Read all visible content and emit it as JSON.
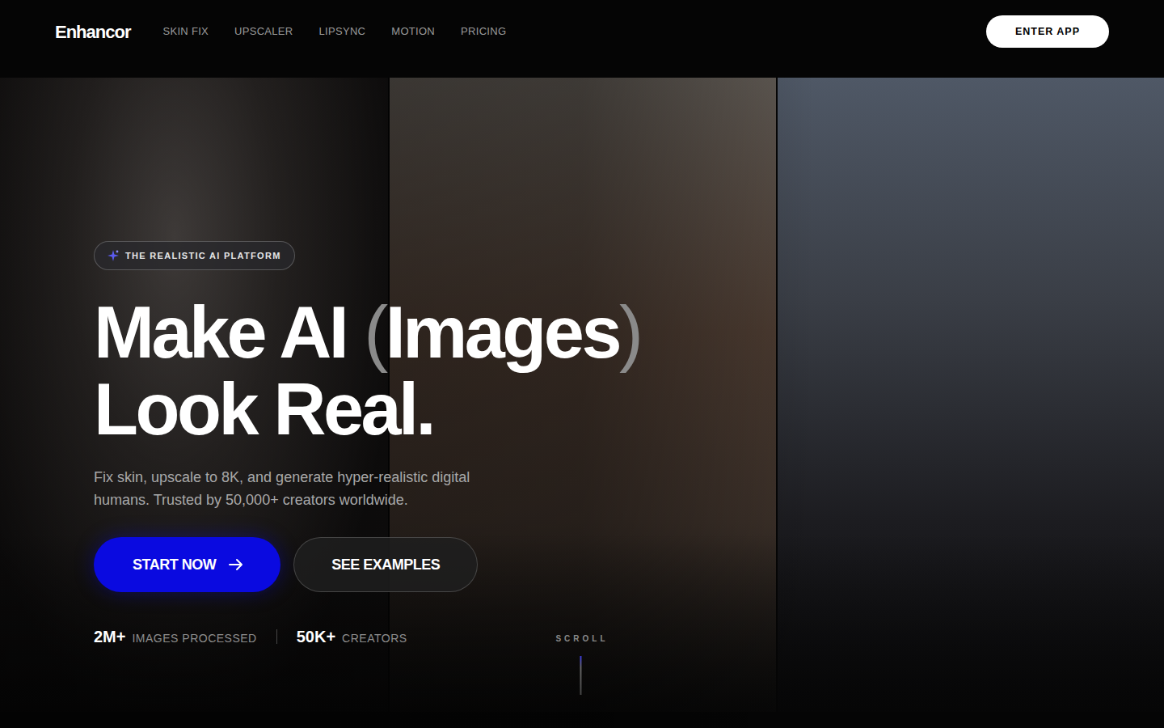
{
  "brand": "Enhancor",
  "nav": [
    {
      "label": "SKIN FIX"
    },
    {
      "label": "UPSCALER"
    },
    {
      "label": "LIPSYNC"
    },
    {
      "label": "MOTION"
    },
    {
      "label": "PRICING"
    }
  ],
  "enter_app": "ENTER APP",
  "hero": {
    "badge": "THE REALISTIC AI PLATFORM",
    "headline": {
      "line1": "Make AI",
      "paren_open": "(",
      "word": "Images",
      "paren_close": ")",
      "line2": "Look Real."
    },
    "subtitle": "Fix skin, upscale to 8K, and generate hyper-realistic digital humans. Trusted by 50,000+ creators worldwide.",
    "buttons": [
      {
        "label": "START NOW",
        "kind": "primary"
      },
      {
        "label": "SEE EXAMPLES",
        "kind": "secondary"
      }
    ],
    "stats": [
      {
        "value": "2M+",
        "label": "IMAGES PROCESSED"
      },
      {
        "value": "50K+",
        "label": "CREATORS"
      }
    ],
    "scroll": "SCROLL"
  }
}
